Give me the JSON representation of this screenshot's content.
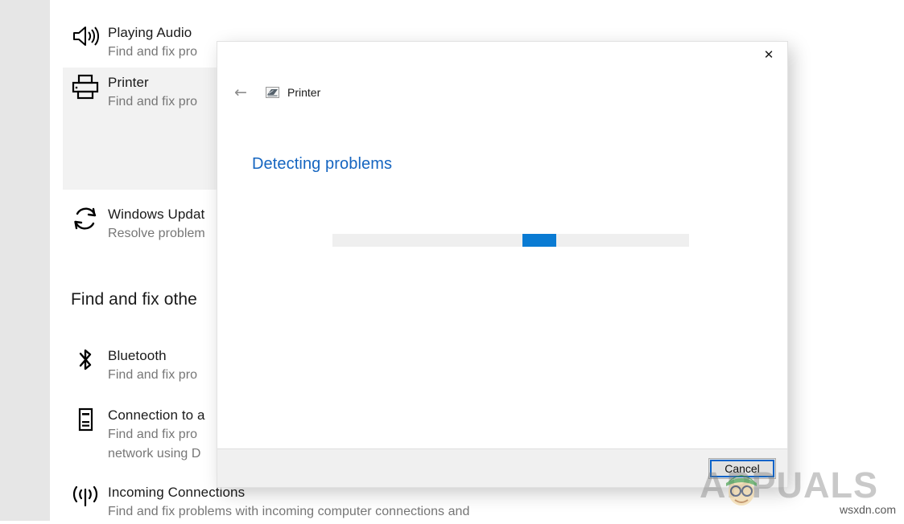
{
  "settings": {
    "troubleshooters": [
      {
        "icon": "speaker-icon",
        "title": "Playing Audio",
        "desc": "Find and fix pro",
        "highlighted": false
      },
      {
        "icon": "printer-icon",
        "title": "Printer",
        "desc": "Find and fix pro",
        "highlighted": true
      },
      {
        "icon": "windows-update-icon",
        "title": "Windows Updat",
        "desc": "Resolve problem",
        "highlighted": false
      }
    ],
    "section_heading": "Find and fix othe",
    "other_troubleshooters": [
      {
        "icon": "bluetooth-icon",
        "title": "Bluetooth",
        "desc": "Find and fix pro",
        "desc2": ""
      },
      {
        "icon": "device-icon",
        "title": "Connection to a",
        "desc": "Find and fix pro",
        "desc2": "network using D"
      },
      {
        "icon": "incoming-connections-icon",
        "title": "Incoming Connections",
        "desc": "Find and fix problems with incoming computer connections and",
        "desc2": ""
      }
    ]
  },
  "dialog": {
    "close_label": "✕",
    "back_label": "←",
    "app_title": "Printer",
    "app_icon": "printer-small-icon",
    "status_heading": "Detecting problems",
    "progress": {
      "indeterminate": true,
      "chunk_left_pct": 53.3,
      "chunk_width_pct": 9.5,
      "track_color": "#efefef",
      "chunk_color": "#0a7bd3"
    },
    "cancel_label": "Cancel"
  },
  "watermark": {
    "brand": "APPUALS",
    "site": "wsxdn.com"
  },
  "colors": {
    "accent_blue": "#0a7bd3",
    "heading_blue": "#1565c0",
    "sidebar_gray": "#e6e6e6",
    "highlight_gray": "#f2f2f2",
    "footer_gray": "#f0f0f0"
  }
}
